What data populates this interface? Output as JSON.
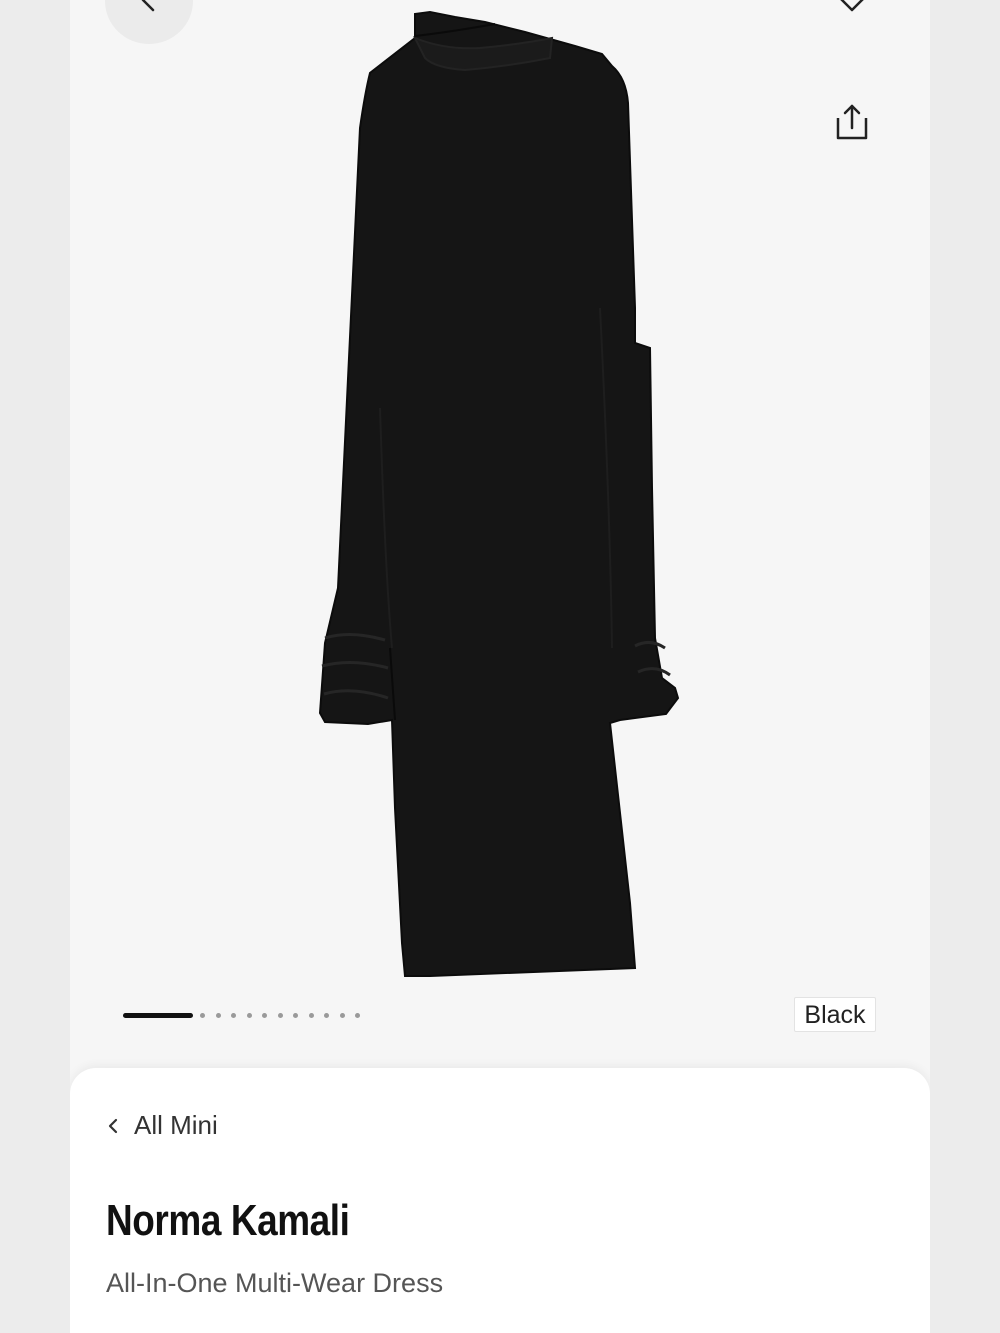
{
  "product": {
    "color": "Black",
    "breadcrumb": "All Mini",
    "brand": "Norma Kamali",
    "name": "All-In-One Multi-Wear Dress"
  },
  "gallery": {
    "image_count": 12,
    "active_index": 0
  },
  "icons": {
    "back": "chevron-left-icon",
    "favorite": "heart-icon",
    "share": "share-icon",
    "breadcrumb": "chevron-left-icon"
  },
  "colors": {
    "dress": "#151515",
    "page_background": "#f6f6f6",
    "card_background": "#ffffff",
    "active_indicator": "#111111",
    "inactive_indicator": "#9a9a9a"
  }
}
